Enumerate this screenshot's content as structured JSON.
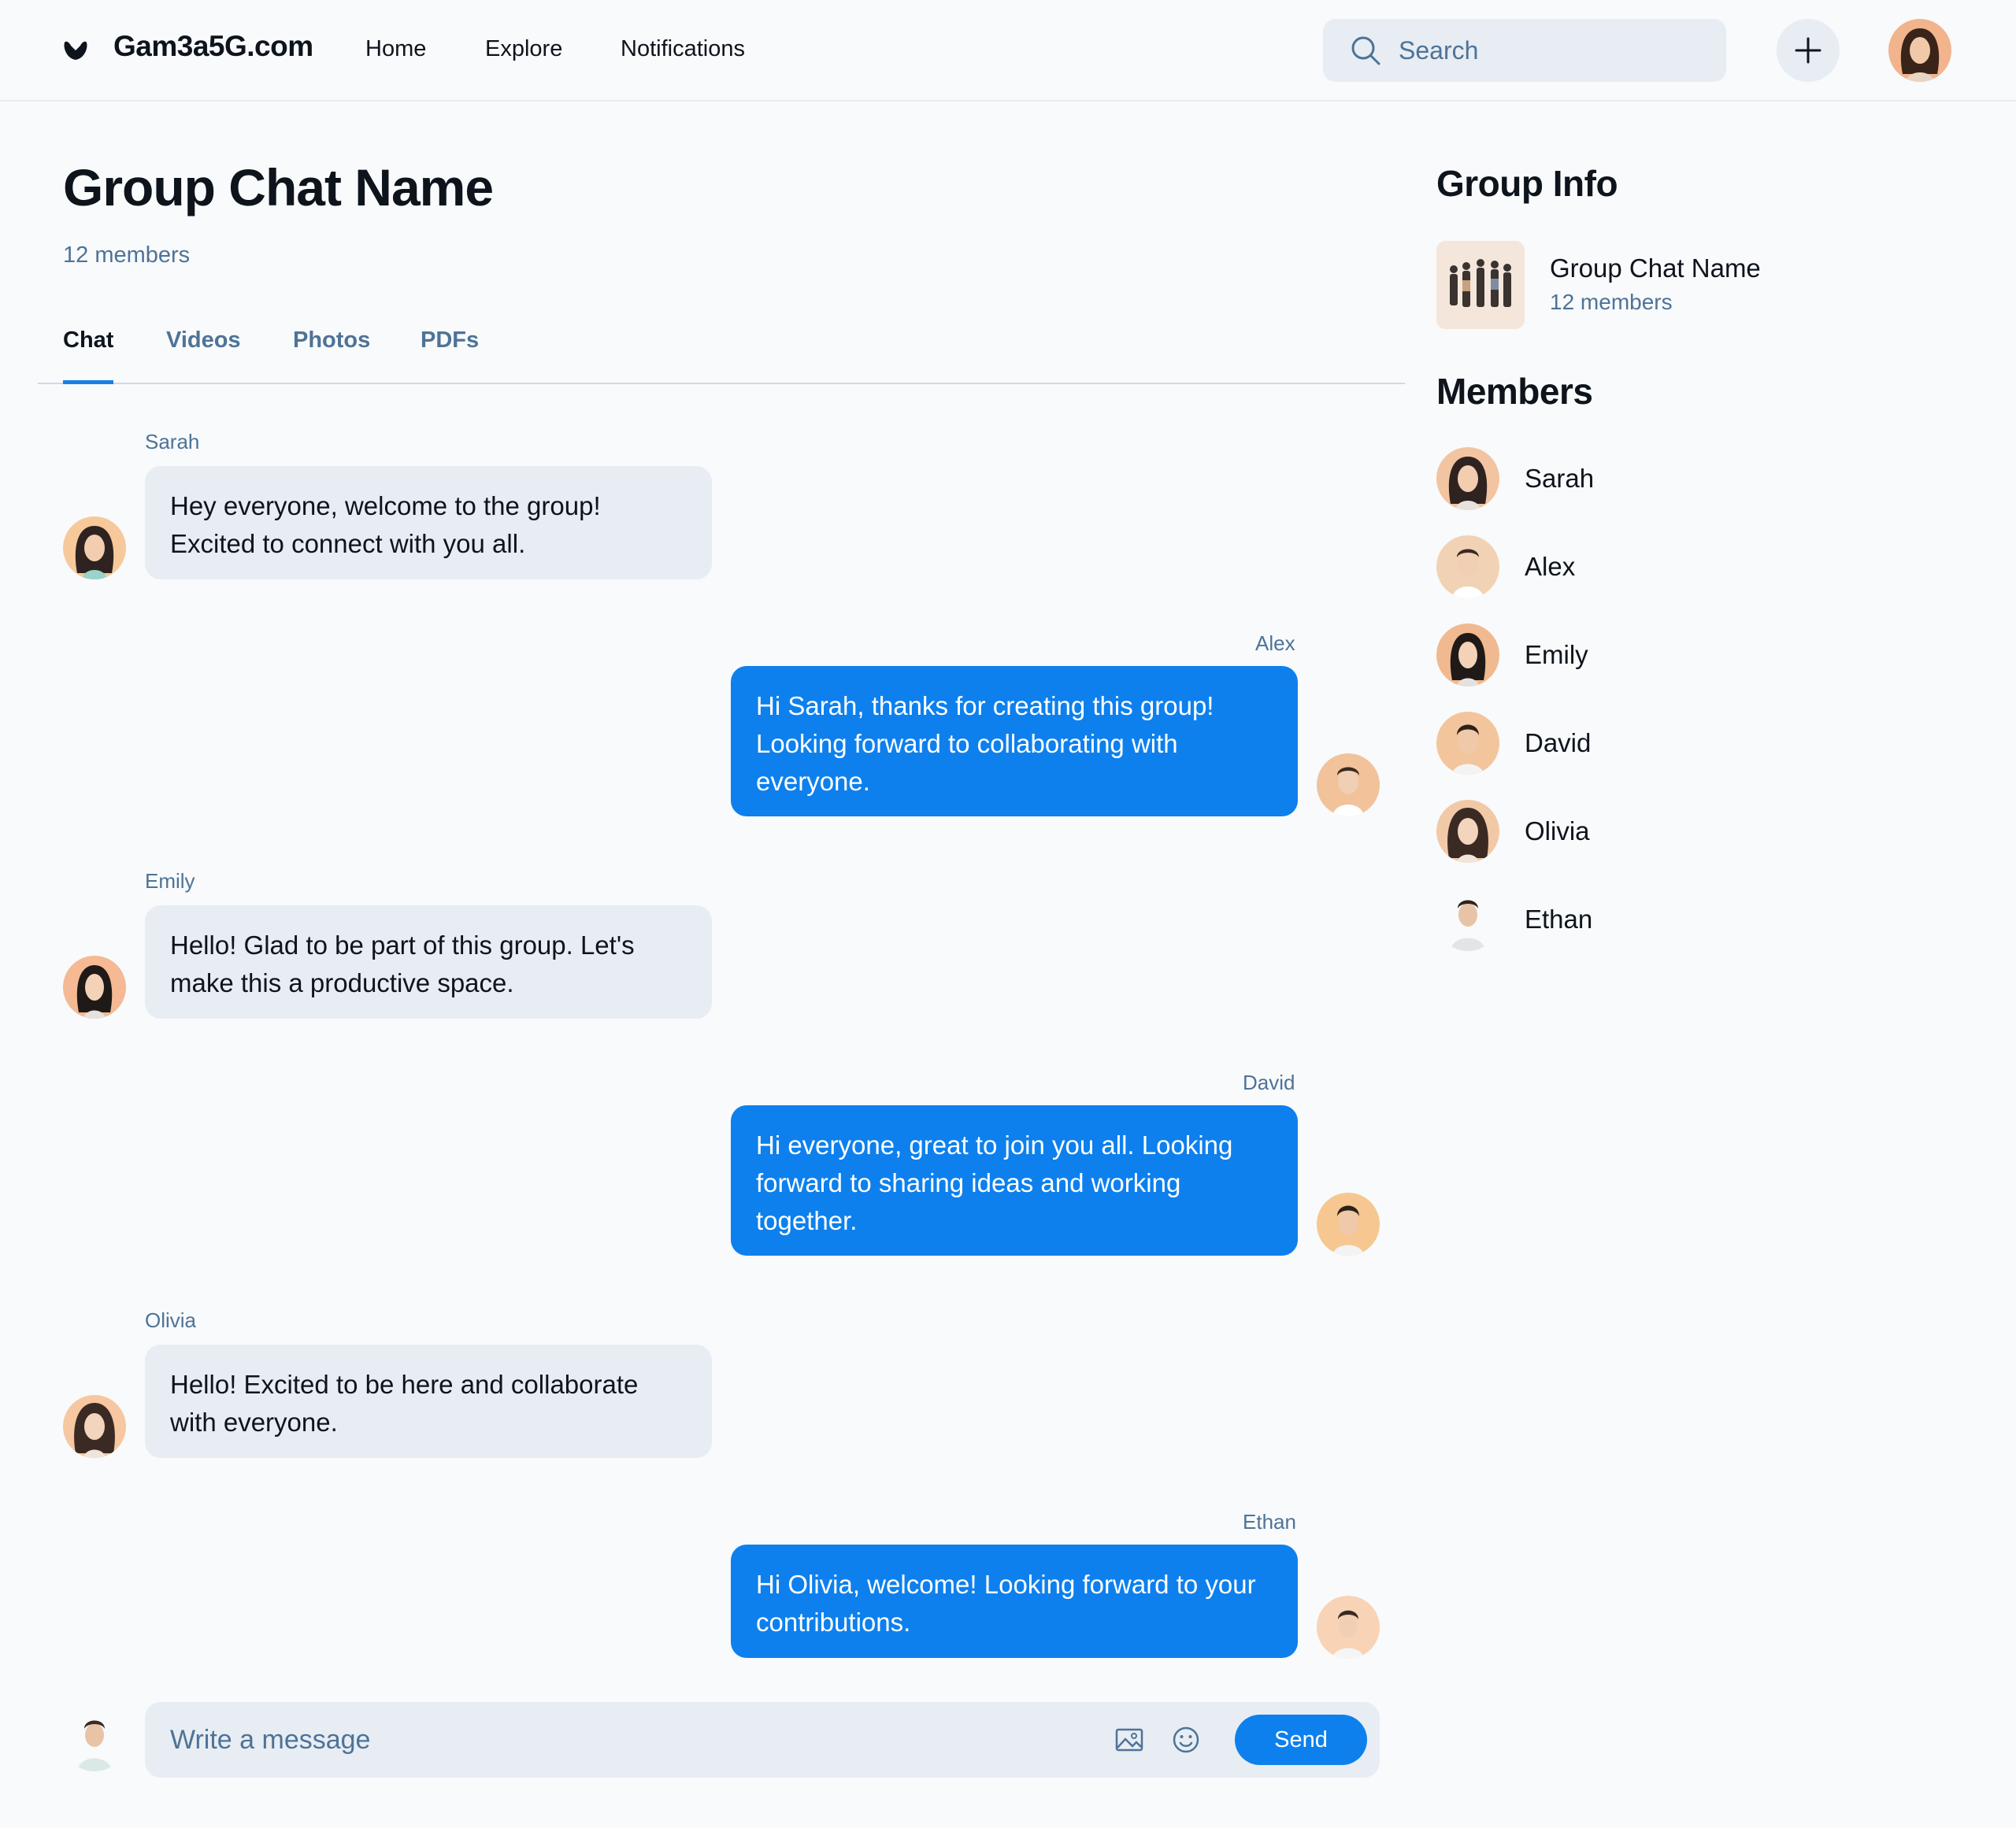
{
  "header": {
    "brand": "Gam3a5G.com",
    "nav": [
      "Home",
      "Explore",
      "Notifications"
    ],
    "search_placeholder": "Search",
    "icons": {
      "logo": "logo-icon",
      "search": "search-icon",
      "add": "plus-icon"
    }
  },
  "chat": {
    "title": "Group Chat Name",
    "member_count": "12 members",
    "tabs": [
      "Chat",
      "Videos",
      "Photos",
      "PDFs"
    ],
    "active_tab": "Chat",
    "messages": [
      {
        "sender": "Sarah",
        "text": "Hey everyone, welcome to the group! Excited to connect with you all.",
        "direction": "incoming"
      },
      {
        "sender": "Alex",
        "text": "Hi Sarah, thanks for creating this group! Looking forward to collaborating with everyone.",
        "direction": "outgoing"
      },
      {
        "sender": "Emily",
        "text": "Hello! Glad to be part of this group. Let's make this a productive space.",
        "direction": "incoming"
      },
      {
        "sender": "David",
        "text": "Hi everyone, great to join you all. Looking forward to sharing ideas and working together.",
        "direction": "outgoing"
      },
      {
        "sender": "Olivia",
        "text": "Hello! Excited to be here and collaborate with everyone.",
        "direction": "incoming"
      },
      {
        "sender": "Ethan",
        "text": "Hi Olivia, welcome! Looking forward to your contributions.",
        "direction": "outgoing"
      }
    ],
    "composer": {
      "placeholder": "Write a message",
      "send_label": "Send",
      "icons": [
        "image-icon",
        "emoji-icon"
      ]
    }
  },
  "sidebar": {
    "group_info_heading": "Group Info",
    "group_name": "Group Chat Name",
    "group_members": "12 members",
    "members_heading": "Members",
    "members": [
      "Sarah",
      "Alex",
      "Emily",
      "David",
      "Olivia",
      "Ethan"
    ]
  },
  "colors": {
    "accent": "#0d80ee",
    "muted_text": "#4e7397",
    "bubble_incoming": "#e7edf3",
    "background": "#f8fafc"
  }
}
